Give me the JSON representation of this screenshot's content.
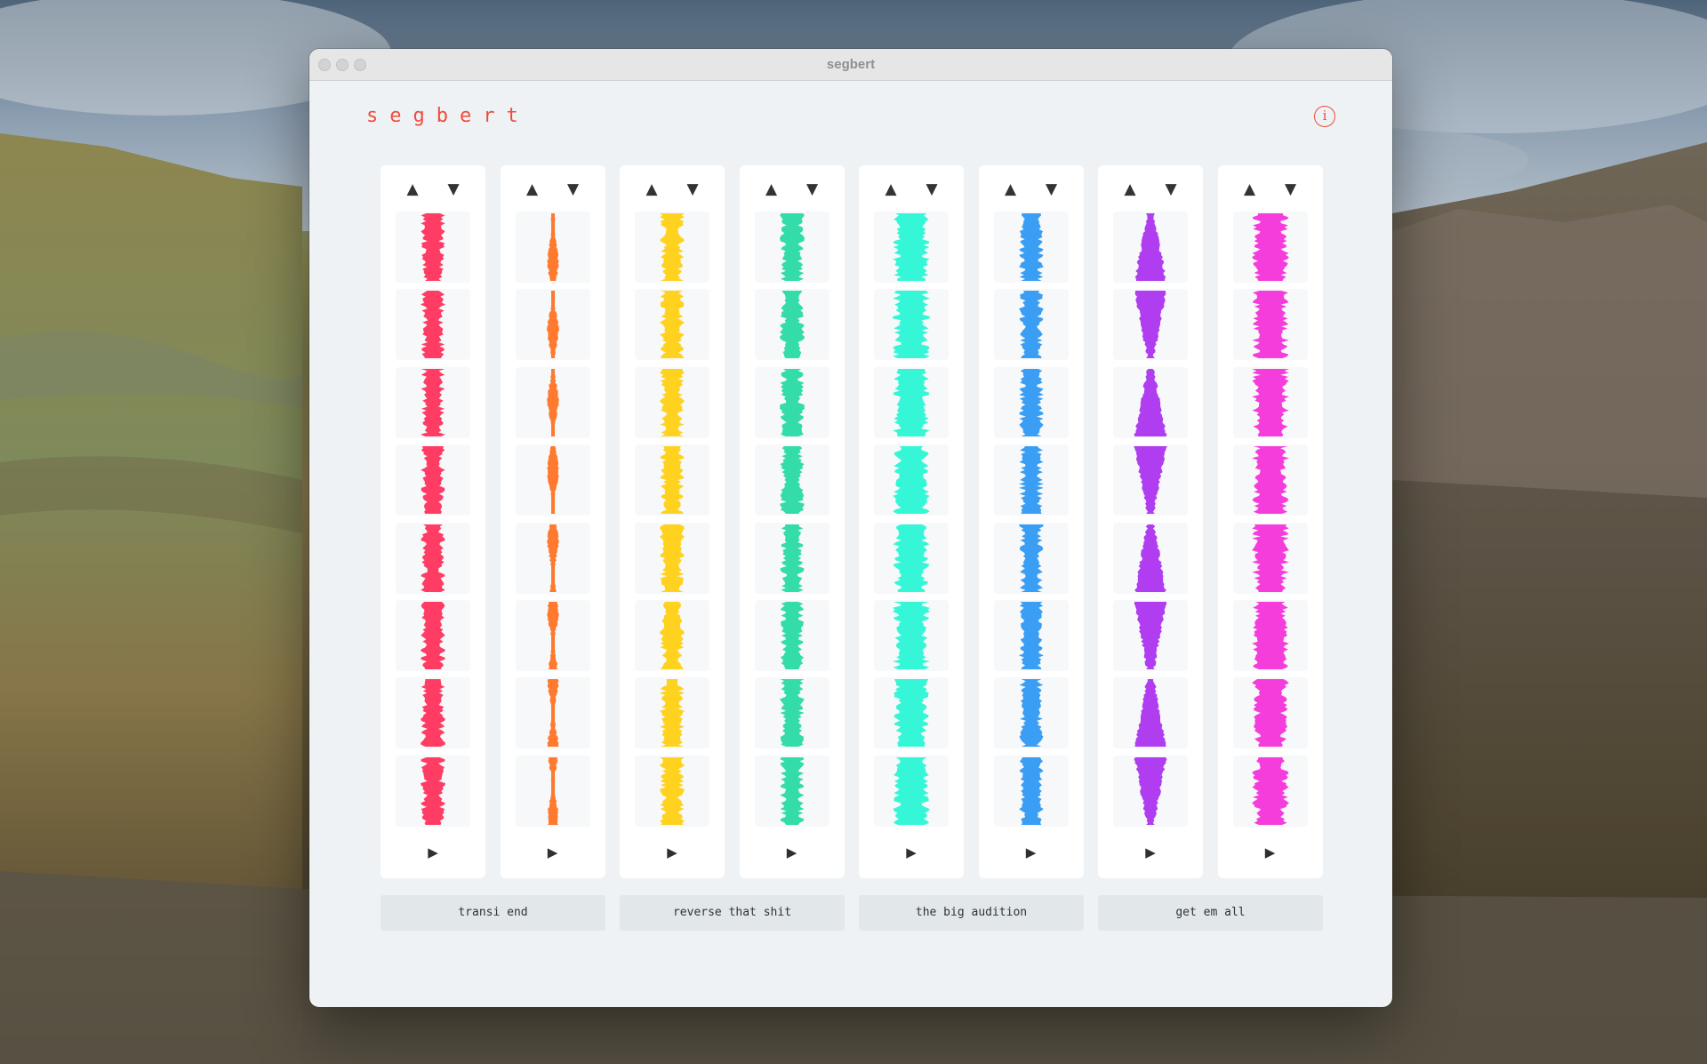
{
  "window": {
    "title": "segbert",
    "buttons": [
      "close",
      "minimize",
      "zoom"
    ]
  },
  "app": {
    "logo": "segbert",
    "info_icon": "info-icon",
    "info_glyph": "i"
  },
  "controls": {
    "move_up_glyph": "▲",
    "move_down_glyph": "▼",
    "play_glyph": "▶"
  },
  "tracks": [
    {
      "color": "#ff3d64",
      "segments": 8
    },
    {
      "color": "#ff7a2e",
      "segments": 8
    },
    {
      "color": "#ffd21f",
      "segments": 8
    },
    {
      "color": "#33dca8",
      "segments": 8
    },
    {
      "color": "#35f7d8",
      "segments": 8
    },
    {
      "color": "#3a9ef5",
      "segments": 8
    },
    {
      "color": "#b03df0",
      "segments": 8
    },
    {
      "color": "#f53ddc",
      "segments": 8
    }
  ],
  "actions": [
    {
      "label": "transi end"
    },
    {
      "label": "reverse that shit"
    },
    {
      "label": "the big audition"
    },
    {
      "label": "get em all"
    }
  ]
}
